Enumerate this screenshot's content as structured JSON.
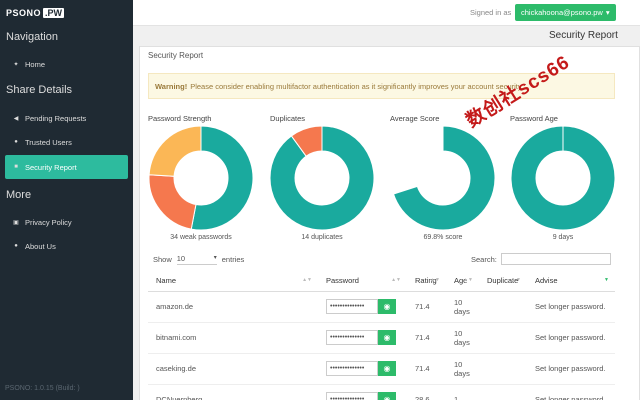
{
  "header": {
    "logo_text": "PSONO",
    "logo_badge": ".PW",
    "signed_in_label": "Signed in as",
    "user": "chickahoona@psono.pw"
  },
  "sidebar": {
    "navigation_heading": "Navigation",
    "share_heading": "Share Details",
    "more_heading": "More",
    "items": [
      {
        "label": "Home",
        "icon": "home-icon"
      },
      {
        "label": "Pending Requests",
        "icon": "share-icon"
      },
      {
        "label": "Trusted Users",
        "icon": "user-icon"
      },
      {
        "label": "Security Report",
        "icon": "report-icon"
      },
      {
        "label": "Privacy Policy",
        "icon": "lock-icon"
      },
      {
        "label": "About Us",
        "icon": "info-icon"
      }
    ],
    "version": "PSONO: 1.0.15 (Build: )"
  },
  "panel": {
    "title": "Security Report",
    "title_right": "Security Report",
    "warning_bold": "Warning!",
    "warning_text": "Please consider enabling multifactor authentication as it significantly improves your account security."
  },
  "charts": {
    "strength_title": "Password Strength",
    "strength_caption": "34 weak passwords",
    "duplicates_title": "Duplicates",
    "duplicates_caption": "14 duplicates",
    "score_title": "Average Score",
    "score_caption": "69.8% score",
    "age_title": "Password Age",
    "age_caption": "9 days"
  },
  "colors": {
    "teal": "#1aaa9e",
    "orange": "#f5784e",
    "yellow": "#fbb756",
    "accent_green": "#2dbb6a"
  },
  "chart_data": [
    {
      "type": "pie",
      "title": "Password Strength",
      "donut": true,
      "slices": [
        {
          "color": "teal",
          "fraction": 0.53
        },
        {
          "color": "orange",
          "fraction": 0.23
        },
        {
          "color": "yellow",
          "fraction": 0.24
        }
      ]
    },
    {
      "type": "pie",
      "title": "Duplicates",
      "donut": true,
      "slices": [
        {
          "color": "teal",
          "fraction": 0.9
        },
        {
          "color": "orange",
          "fraction": 0.1
        }
      ]
    },
    {
      "type": "pie",
      "title": "Average Score",
      "donut": true,
      "slices": [
        {
          "color": "teal",
          "fraction": 0.7
        },
        {
          "color": "none",
          "fraction": 0.3
        }
      ]
    },
    {
      "type": "pie",
      "title": "Password Age",
      "donut": true,
      "slices": [
        {
          "color": "teal",
          "fraction": 1.0
        }
      ]
    }
  ],
  "table_controls": {
    "show_label": "Show",
    "show_value": "10",
    "entries_label": "entries",
    "search_label": "Search:"
  },
  "table": {
    "headers": [
      "Name",
      "Password",
      "Rating",
      "Age",
      "Duplicate",
      "Advise"
    ],
    "rows": [
      {
        "name": "amazon.de",
        "password": "••••••••••••••",
        "rating": "71.4",
        "age1": "10",
        "age2": "days",
        "duplicate": "",
        "advise": "Set longer password."
      },
      {
        "name": "bitnami.com",
        "password": "••••••••••••••",
        "rating": "71.4",
        "age1": "10",
        "age2": "days",
        "duplicate": "",
        "advise": "Set longer password."
      },
      {
        "name": "caseking.de",
        "password": "••••••••••••••",
        "rating": "71.4",
        "age1": "10",
        "age2": "days",
        "duplicate": "",
        "advise": "Set longer password."
      },
      {
        "name": "DCNuernberg",
        "password": "••••••••••••••",
        "rating": "28.6",
        "age1": "1",
        "age2": "",
        "duplicate": "",
        "advise": "Set longer password."
      }
    ]
  },
  "watermark": "数创社scs66"
}
